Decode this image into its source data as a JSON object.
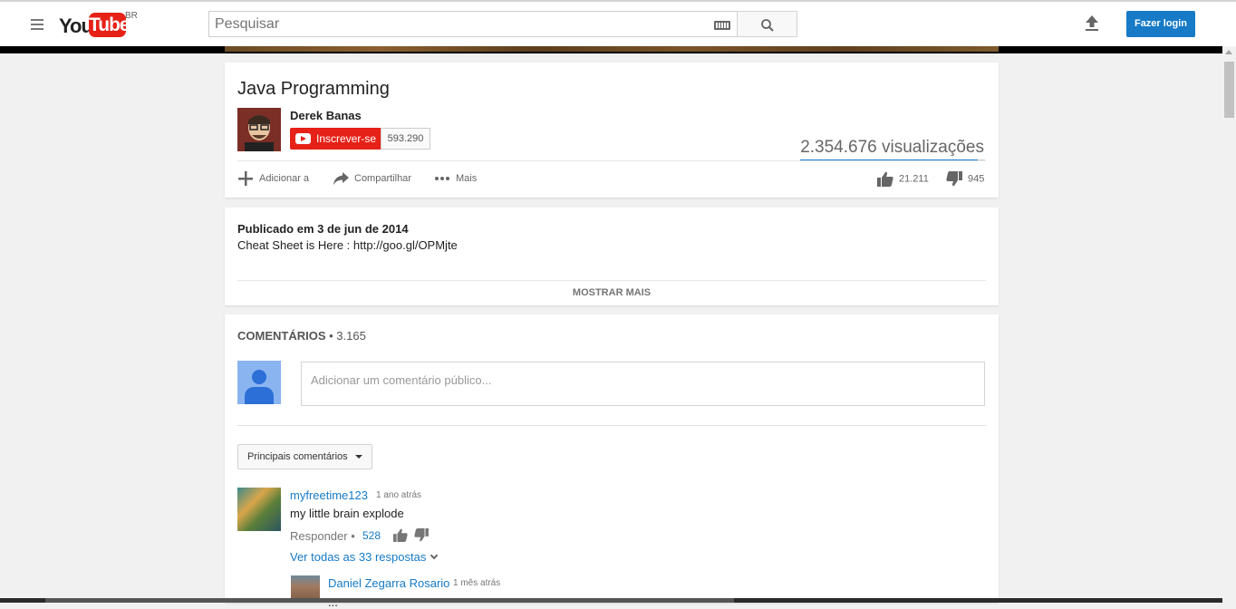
{
  "header": {
    "logo_you": "You",
    "logo_tube": "Tube",
    "country": "BR",
    "search_placeholder": "Pesquisar",
    "login_label": "Fazer login"
  },
  "video": {
    "title": "Java Programming",
    "channel": "Derek Banas",
    "subscribe_label": "Inscrever-se",
    "subscriber_count": "593.290",
    "views": "2.354.676 visualizações",
    "like_ratio": 0.96,
    "actions": {
      "add": "Adicionar a",
      "share": "Compartilhar",
      "more": "Mais"
    },
    "likes": "21.211",
    "dislikes": "945"
  },
  "description": {
    "published": "Publicado em 3 de jun de 2014",
    "text": "Cheat Sheet is Here : http://goo.gl/OPMjte",
    "show_more": "MOSTRAR MAIS"
  },
  "comments": {
    "title": "COMENTÁRIOS",
    "count": " • 3.165",
    "input_placeholder": "Adicionar um comentário público...",
    "sort_label": "Principais comentários",
    "items": [
      {
        "author": "myfreetime123",
        "time": "1 ano atrás",
        "text": "my little brain explode",
        "reply_label": "Responder",
        "sep": " •",
        "likes": "528",
        "view_replies": "Ver todas as 33 respostas"
      }
    ],
    "replies": [
      {
        "author": "Daniel Zegarra Rosario",
        "time": "1 mês atrás",
        "text": "..."
      }
    ]
  },
  "colors": {
    "accent": "#167ac6",
    "brand": "#e62117"
  }
}
